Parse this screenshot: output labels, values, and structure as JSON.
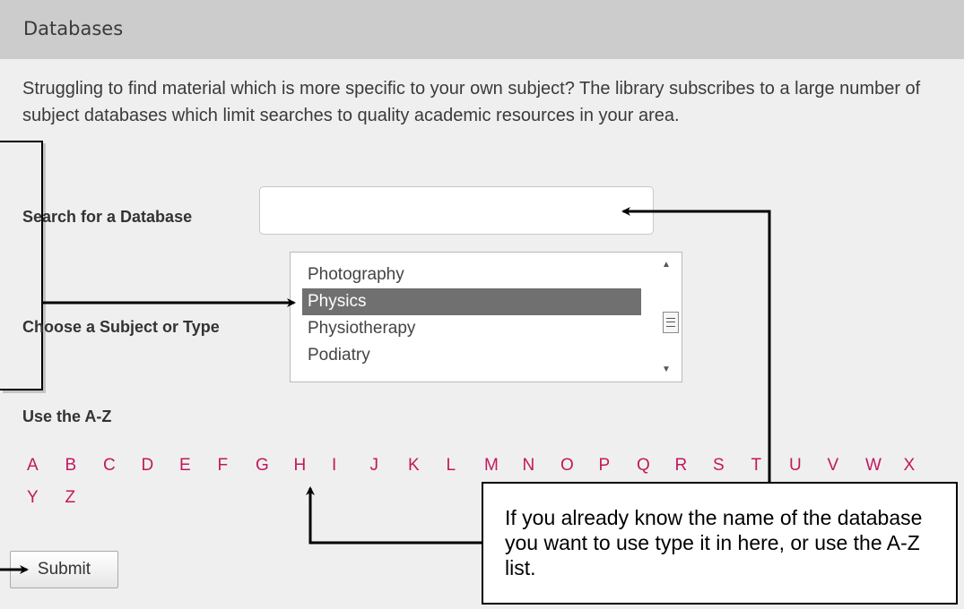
{
  "header": {
    "title": "Databases"
  },
  "intro": {
    "text": "Struggling to find material which is more specific to your own subject? The library subscribes to a large number of subject databases which limit searches to quality academic resources in your area."
  },
  "search": {
    "label": "Search for a Database",
    "value": "",
    "placeholder": ""
  },
  "subject": {
    "label": "Choose a Subject or Type",
    "options": [
      "Photography",
      "Physics",
      "Physiotherapy",
      "Podiatry"
    ],
    "selected": "Physics"
  },
  "az": {
    "label": "Use the A-Z",
    "row1": [
      "A",
      "B",
      "C",
      "D",
      "E",
      "F",
      "G",
      "H",
      "I",
      "J",
      "K",
      "L",
      "M",
      "N",
      "O",
      "P",
      "Q",
      "R",
      "S",
      "T",
      "U",
      "V",
      "W",
      "X"
    ],
    "row2": [
      "Y",
      "Z"
    ]
  },
  "submit": {
    "label": "Submit"
  },
  "callout": {
    "text": "If you already know the name of the database you want to use type it in here, or use the A-Z list."
  },
  "colors": {
    "header_bg": "#cccccc",
    "page_bg": "#efefef",
    "link": "#c2185b",
    "selected_bg": "#707070"
  }
}
